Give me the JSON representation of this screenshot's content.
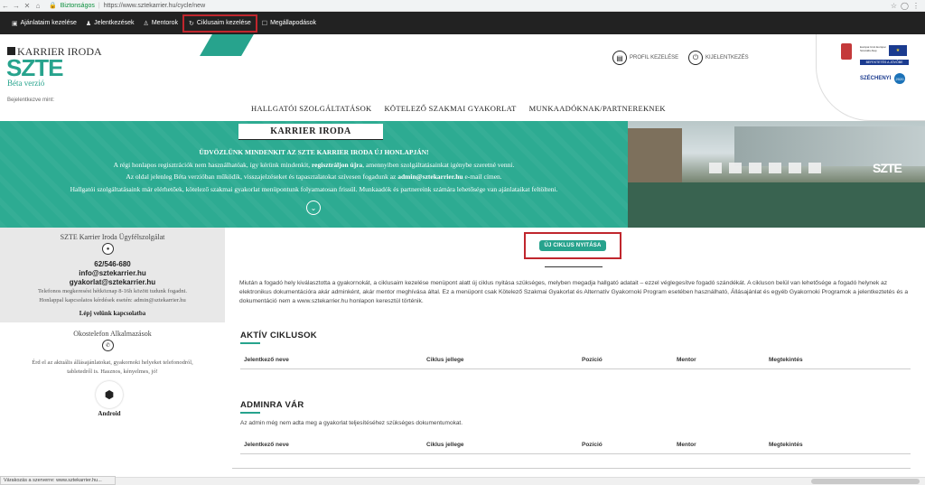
{
  "browser": {
    "secure_label": "Biztonságos",
    "url": "https://www.sztekarrier.hu/cycle/new",
    "back": "←",
    "forward": "→",
    "stop": "✕",
    "home": "⌂",
    "menu_icons": [
      "☆",
      "◯",
      "⋮"
    ]
  },
  "admin_toolbar": {
    "items": [
      {
        "label": "Ajánlataim kezelése",
        "icon": "briefcase-icon"
      },
      {
        "label": "Jelentkezések",
        "icon": "users-icon"
      },
      {
        "label": "Mentorok",
        "icon": "user-icon"
      },
      {
        "label": "Ciklusaim kezelése",
        "icon": "cycle-icon",
        "active": true
      },
      {
        "label": "Megállapodások",
        "icon": "document-icon"
      }
    ]
  },
  "header": {
    "logo_karrier": "KARRIER IRODA",
    "logo_szte": "SZTE",
    "logo_beta": "Béta verzió",
    "logged_in_label": "Bejelentkezve mint:",
    "profile_button": "PROFIL KEZELÉSE",
    "logout_button": "KIJELENTKEZÉS",
    "eu_text": "Európai Unió Európai Szociális Alap",
    "eu_strip": "BEFEKTETÉS A JÖVŐBE",
    "szechenyi": "SZÉCHENYI",
    "szechenyi_num": "2020"
  },
  "main_nav": [
    "HALLGATÓI SZOLGÁLTATÁSOK",
    "KÖTELEZŐ SZAKMAI GYAKORLAT",
    "MUNKAADÓKNAK/PARTNEREKNEK"
  ],
  "banner": {
    "tab": "KARRIER IRODA",
    "line1": "ÜDVÖZLÜNK MINDENKIT AZ SZTE KARRIER IRODA ÚJ HONLAPJÁN!",
    "line2a": "A régi honlapos regisztrációk nem használhatóak, így kérünk mindenkit,",
    "line2b": "regisztráljon újra",
    "line2c": ", amennyiben szolgáltatásainkat igénybe szeretné venni.",
    "line3a": "Az oldal jelenleg Béta verzióban működik, visszajelzéseket és tapasztalatokat szívesen fogadunk az",
    "line3b": "admin@sztekarrier.hu",
    "line3c": "e-mail címen.",
    "line4": "Hallgatói szolgáltatásaink már elérhetőek, kötelező szakmai gyakorlat menüpontunk folyamatosan frissül. Munkaadók és partnereink számára lehetősége van ajánlataikat feltölteni.",
    "photo_logo": "SZTE"
  },
  "sidebar": {
    "service_title": "SZTE Karrier Iroda Ügyfélszolgálat",
    "phone": "62/546-680",
    "email1": "info@sztekarrier.hu",
    "email2": "gyakorlat@sztekarrier.hu",
    "note1": "Telefonos megkeresést hétköznap 8-16h között tudunk fogadni.",
    "note2": "Honlappal kapcsolatos kérdések esetén: admin@sztekarrier.hu",
    "contact_link": "Lépj velünk kapcsolatba",
    "apps_title": "Okostelefon Alkalmazások",
    "apps_text_1": "Érd el az aktuális állásajánlatokat, gyakornoki helyeket telefonodról,",
    "apps_text_2": "tabletedről is. Hasznos, kényelmes, jó!",
    "android_label": "Android"
  },
  "main": {
    "new_cycle_button": "ÚJ CIKLUS NYITÁSA",
    "intro": "Miután a fogadó hely kiválasztotta a gyakornokát, a ciklusaim kezelése menüpont alatt új ciklus nyitása szükséges, melyben megadja hallgató adatait – ezzel véglegesítve fogadó szándékát. A cikluson belül van lehetősége a fogadó helynek az elektronikus dokumentációra akár adminként, akár mentor meghívása által. Ez a menüpont csak Kötelező Szakmai Gyakorlat és Alternatív Gyakornoki Program esetében használható, Állásajánlat és egyéb Gyakornoki Programok a jelentkeztetés és a dokumentáció nem a www.sztekarrier.hu honlapon keresztül történik.",
    "active_title": "AKTÍV CIKLUSOK",
    "pending_title": "ADMINRA VÁR",
    "pending_note": "Az admin még nem adta meg a gyakorlat teljesítéséhez szükséges dokumentumokat.",
    "columns": [
      "Jelentkező neve",
      "Ciklus jellege",
      "Pozíció",
      "Mentor",
      "Megtekintés"
    ]
  },
  "status_bar": "Várakozás a szerverre: www.sztekarrier.hu..."
}
